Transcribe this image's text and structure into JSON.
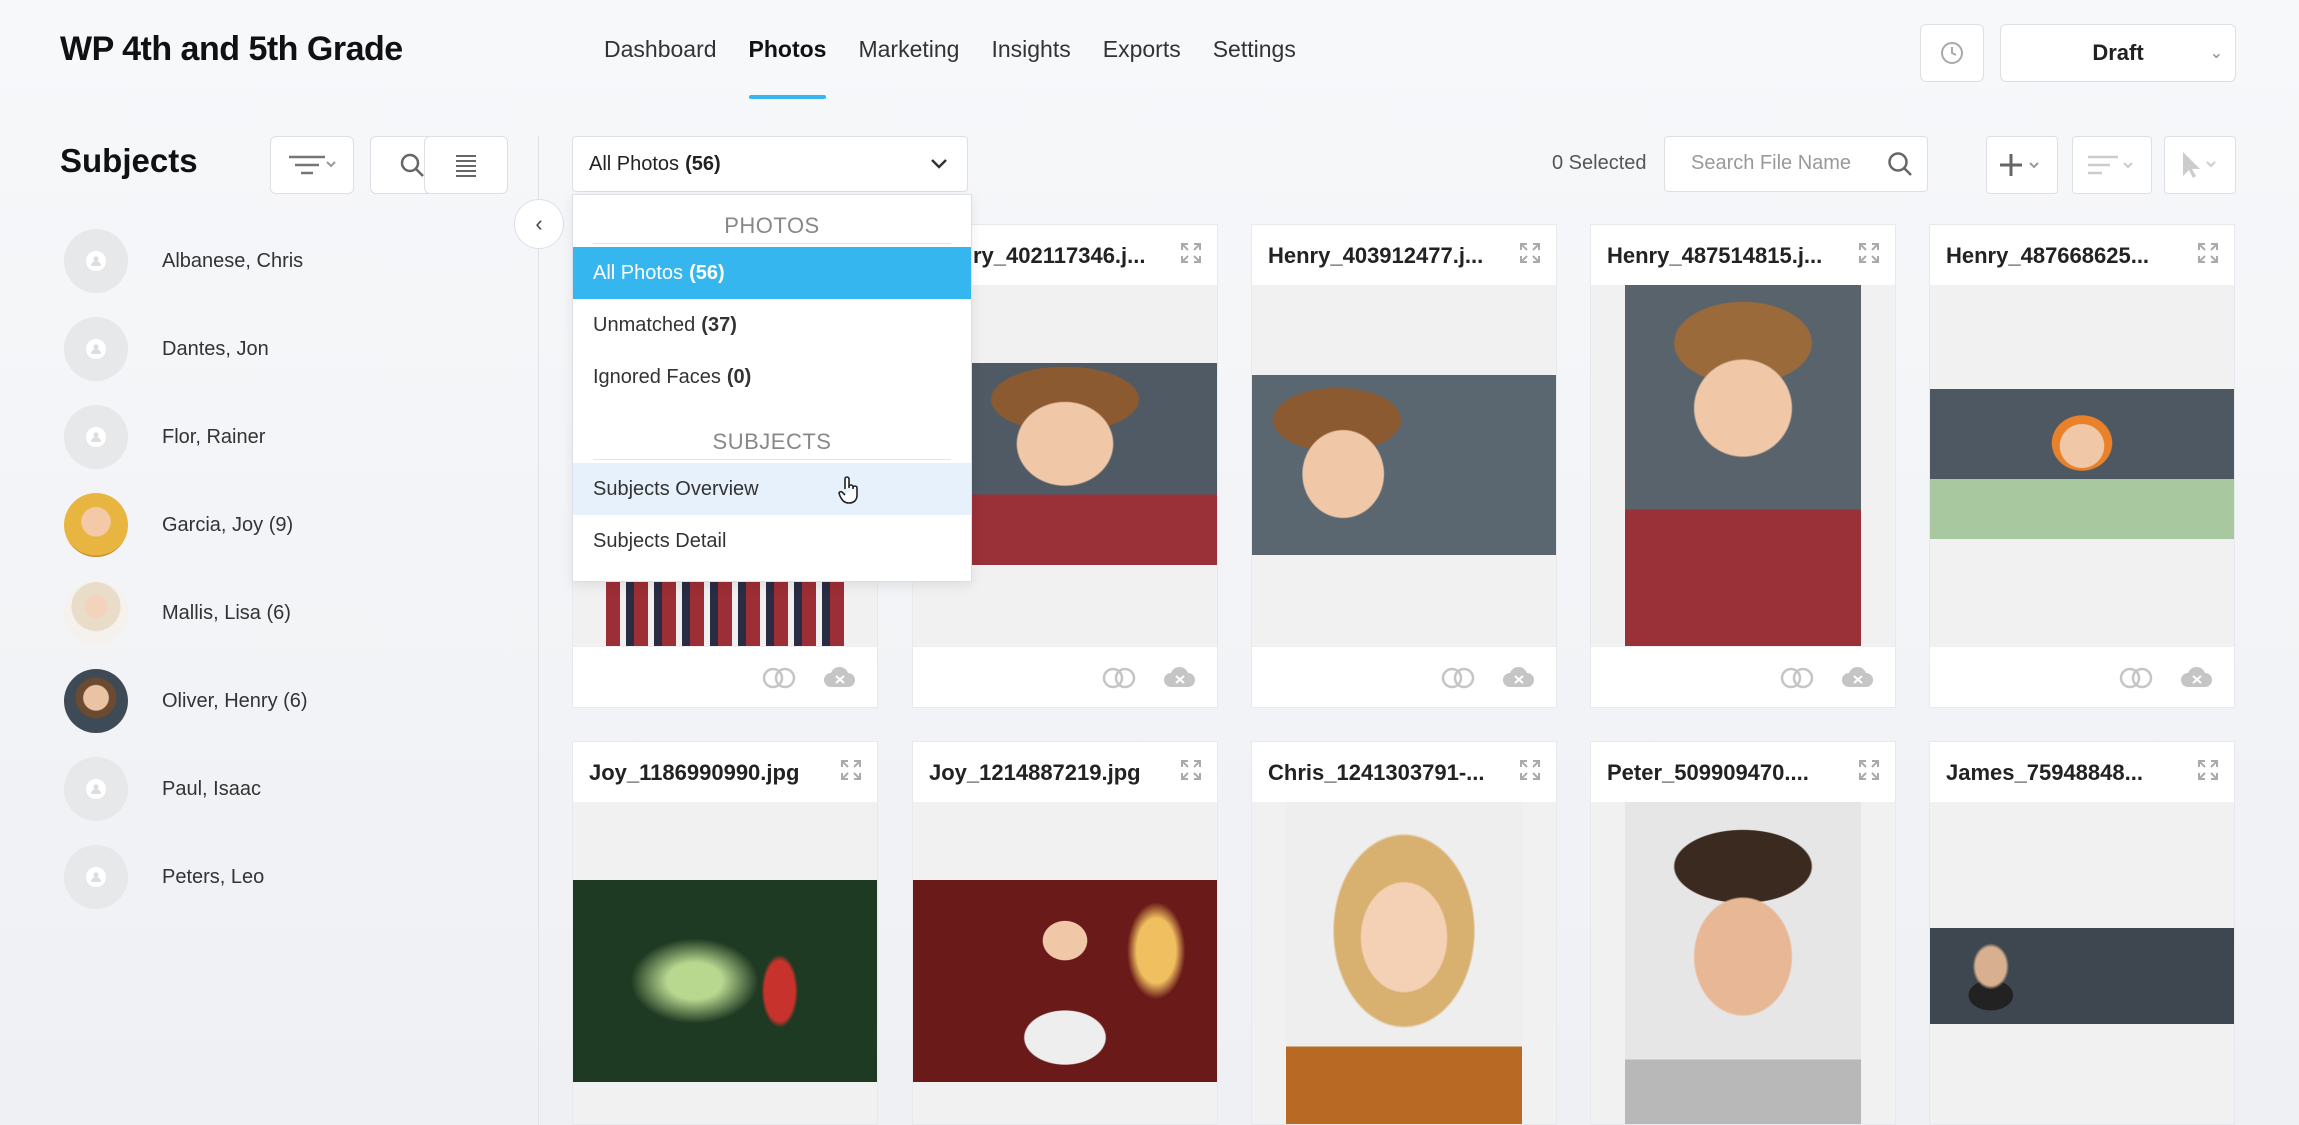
{
  "app": {
    "title": "WP 4th and 5th Grade"
  },
  "nav": {
    "items": [
      "Dashboard",
      "Photos",
      "Marketing",
      "Insights",
      "Exports",
      "Settings"
    ],
    "active": "Photos"
  },
  "header": {
    "status_label": "Draft"
  },
  "sidebar": {
    "title": "Subjects",
    "subjects": [
      {
        "name": "Albanese, Chris",
        "avatar": "placeholder"
      },
      {
        "name": "Dantes, Jon",
        "avatar": "placeholder"
      },
      {
        "name": "Flor, Rainer",
        "avatar": "placeholder"
      },
      {
        "name": "Garcia, Joy (9)",
        "avatar": "photo"
      },
      {
        "name": "Mallis, Lisa (6)",
        "avatar": "photo"
      },
      {
        "name": "Oliver, Henry (6)",
        "avatar": "photo"
      },
      {
        "name": "Paul, Isaac",
        "avatar": "placeholder"
      },
      {
        "name": "Peters, Leo",
        "avatar": "placeholder"
      }
    ]
  },
  "toolbar": {
    "filter_label": "All Photos",
    "filter_count": "(56)",
    "selected_text": "0 Selected",
    "search_placeholder": "Search File Name"
  },
  "dropdown": {
    "photos_header": "PHOTOS",
    "photo_options": [
      {
        "label": "All Photos",
        "count": "(56)"
      },
      {
        "label": "Unmatched",
        "count": "(37)"
      },
      {
        "label": "Ignored Faces",
        "count": "(0)"
      }
    ],
    "subjects_header": "SUBJECTS",
    "subject_options": [
      "Subjects Overview",
      "Subjects Detail"
    ]
  },
  "photos": [
    {
      "file": "Henry_402117346.j...",
      "visible_file": "ry_402117346.j..."
    },
    {
      "file": "Henry_403912477.j..."
    },
    {
      "file": "Henry_487514815.j..."
    },
    {
      "file": "Henry_487668625..."
    },
    {
      "file": "Joy_1186990990.jpg"
    },
    {
      "file": "Joy_1214887219.jpg"
    },
    {
      "file": "Chris_1241303791-..."
    },
    {
      "file": "Peter_509909470...."
    },
    {
      "file": "James_75948848..."
    }
  ],
  "colors": {
    "accent": "#35b6ee",
    "hover": "#e6f1fb"
  }
}
